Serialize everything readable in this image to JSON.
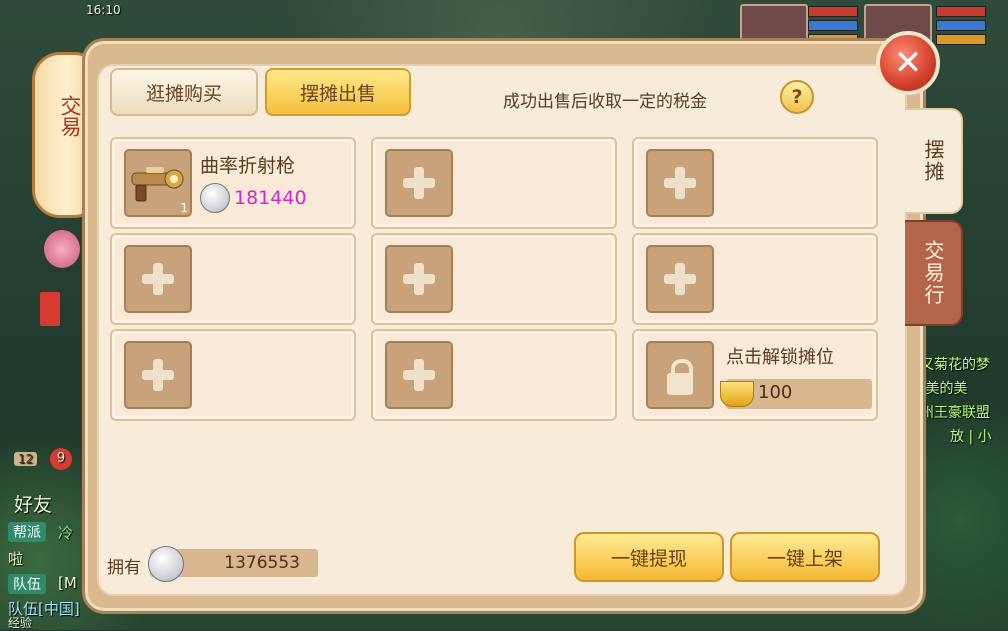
{
  "background": {
    "friends_label": "好友",
    "chat": [
      {
        "channel": "帮派",
        "text": "冷",
        "color": "#2f8b6a"
      },
      {
        "channel": "队伍",
        "text": "[M",
        "color": "#2f8b6a"
      }
    ],
    "chat_misc": [
      "啦",
      "队伍[中国]"
    ],
    "exp_label": "经验",
    "right_texts": [
      "蒸又菊花的梦",
      "传]美的美",
      "九州王豪联盟",
      "放 | 小"
    ],
    "badges": {
      "level": "12",
      "notice": "9"
    },
    "time": "16:10"
  },
  "lantern": {
    "title": "交易"
  },
  "tabs": {
    "browse": "逛摊购买",
    "sell": "摆摊出售"
  },
  "tax_note": "成功出售后收取一定的税金",
  "help": "?",
  "close": "✕",
  "side_tabs": {
    "stall": "摆摊",
    "market": "交易行"
  },
  "slots": [
    {
      "type": "item",
      "name": "曲率折射枪",
      "price": "181440",
      "count": "1"
    },
    {
      "type": "empty"
    },
    {
      "type": "empty"
    },
    {
      "type": "empty"
    },
    {
      "type": "empty"
    },
    {
      "type": "empty"
    },
    {
      "type": "empty"
    },
    {
      "type": "empty"
    },
    {
      "type": "locked",
      "label": "点击解锁摊位",
      "cost": "100"
    }
  ],
  "owned": {
    "label": "拥有",
    "value": "1376553"
  },
  "buttons": {
    "withdraw": "一键提现",
    "list": "一键上架"
  },
  "colors": {
    "accent": "#f4bf3c",
    "price": "#d126d1",
    "panel": "#f6ecd9"
  }
}
